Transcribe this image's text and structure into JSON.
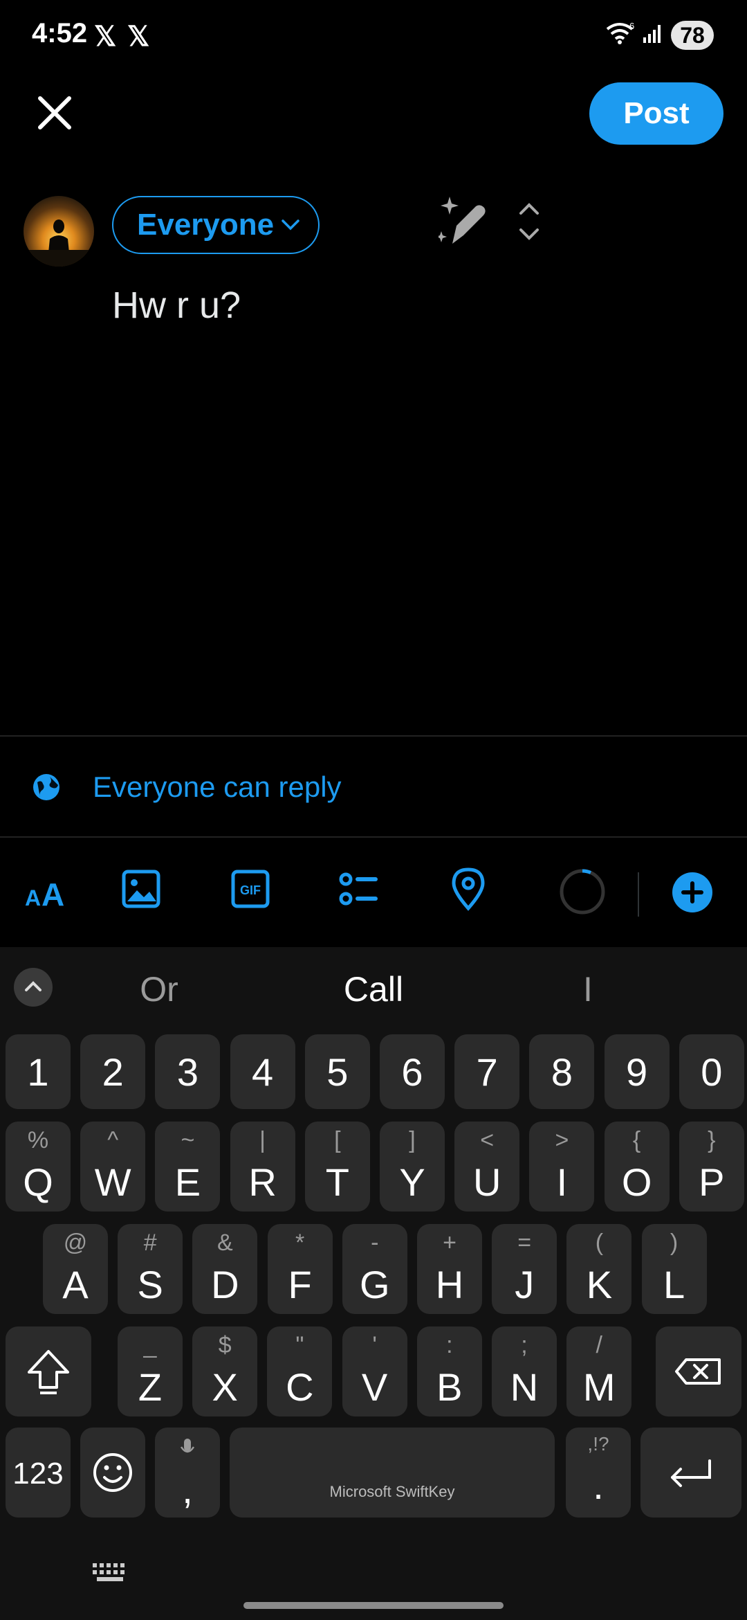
{
  "status_bar": {
    "time": "4:52",
    "x_logo": "𝕏",
    "battery": "78",
    "wifi_label": "6"
  },
  "compose": {
    "post_label": "Post",
    "audience_label": "Everyone",
    "text": "Hw r u?",
    "reply_setting": "Everyone can reply"
  },
  "toolbar": {
    "text_format_icon": "AA",
    "gif_label": "GIF"
  },
  "keyboard": {
    "suggestions": [
      "Or",
      "Call",
      "I"
    ],
    "numbers": [
      "1",
      "2",
      "3",
      "4",
      "5",
      "6",
      "7",
      "8",
      "9",
      "0"
    ],
    "row1": [
      {
        "main": "Q",
        "sub": "%"
      },
      {
        "main": "W",
        "sub": "^"
      },
      {
        "main": "E",
        "sub": "~"
      },
      {
        "main": "R",
        "sub": "|"
      },
      {
        "main": "T",
        "sub": "["
      },
      {
        "main": "Y",
        "sub": "]"
      },
      {
        "main": "U",
        "sub": "<"
      },
      {
        "main": "I",
        "sub": ">"
      },
      {
        "main": "O",
        "sub": "{"
      },
      {
        "main": "P",
        "sub": "}"
      }
    ],
    "row2": [
      {
        "main": "A",
        "sub": "@"
      },
      {
        "main": "S",
        "sub": "#"
      },
      {
        "main": "D",
        "sub": "&"
      },
      {
        "main": "F",
        "sub": "*"
      },
      {
        "main": "G",
        "sub": "-"
      },
      {
        "main": "H",
        "sub": "+"
      },
      {
        "main": "J",
        "sub": "="
      },
      {
        "main": "K",
        "sub": "("
      },
      {
        "main": "L",
        "sub": ")"
      }
    ],
    "row3": [
      {
        "main": "Z",
        "sub": "_"
      },
      {
        "main": "X",
        "sub": "$"
      },
      {
        "main": "C",
        "sub": "\""
      },
      {
        "main": "V",
        "sub": "'"
      },
      {
        "main": "B",
        "sub": ":"
      },
      {
        "main": "N",
        "sub": ";"
      },
      {
        "main": "M",
        "sub": "/"
      }
    ],
    "num_mode": "123",
    "comma": ",",
    "period": ".",
    "period_sub": ",!?",
    "space_label": "Microsoft SwiftKey"
  }
}
